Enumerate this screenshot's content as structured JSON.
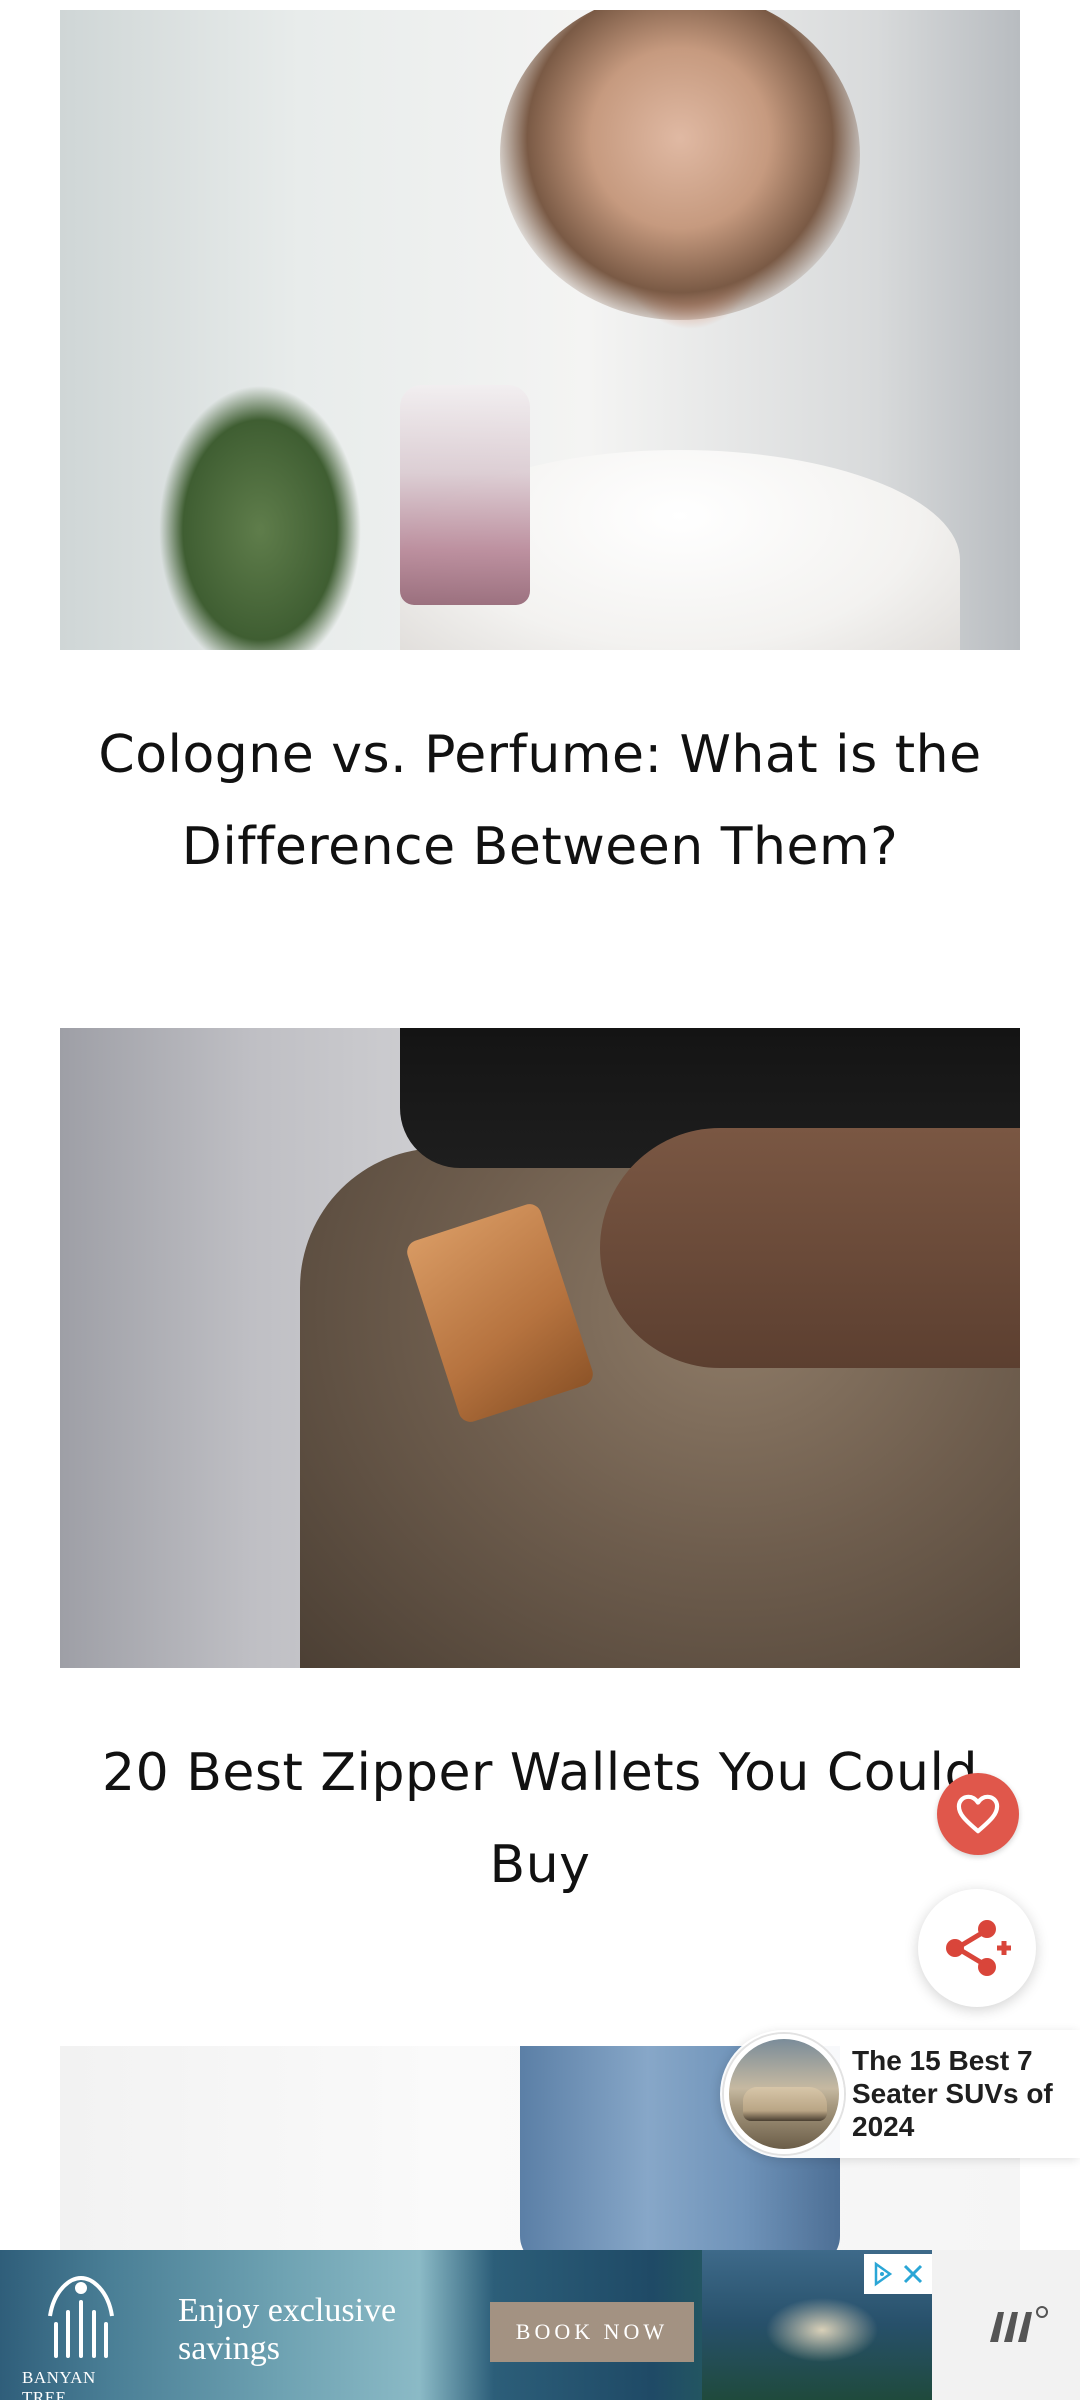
{
  "feed": {
    "articles": [
      {
        "title": "Cologne vs. Perfume: What is the Difference Between Them?",
        "image": "woman-spraying-perfume-photo"
      },
      {
        "title": "20 Best Zipper Wallets You Could Buy",
        "image": "wallet-in-pocket-photo"
      },
      {
        "title": "",
        "image": "jeans-photo"
      }
    ]
  },
  "floating": {
    "favorite_icon": "heart-icon",
    "share_icon": "share-plus-icon",
    "accent_color": "#e0574b"
  },
  "recommendation": {
    "title": "The 15 Best 7 Seater SUVs of 2024",
    "thumbnail": "suv-car-photo"
  },
  "ad": {
    "brand": "BANYAN TREE",
    "headline": "Enjoy exclusive savings",
    "cta": "BOOK NOW",
    "choices_icons": [
      "adchoices-icon",
      "close-icon"
    ],
    "network_icon": "mediavine-logo-icon"
  }
}
